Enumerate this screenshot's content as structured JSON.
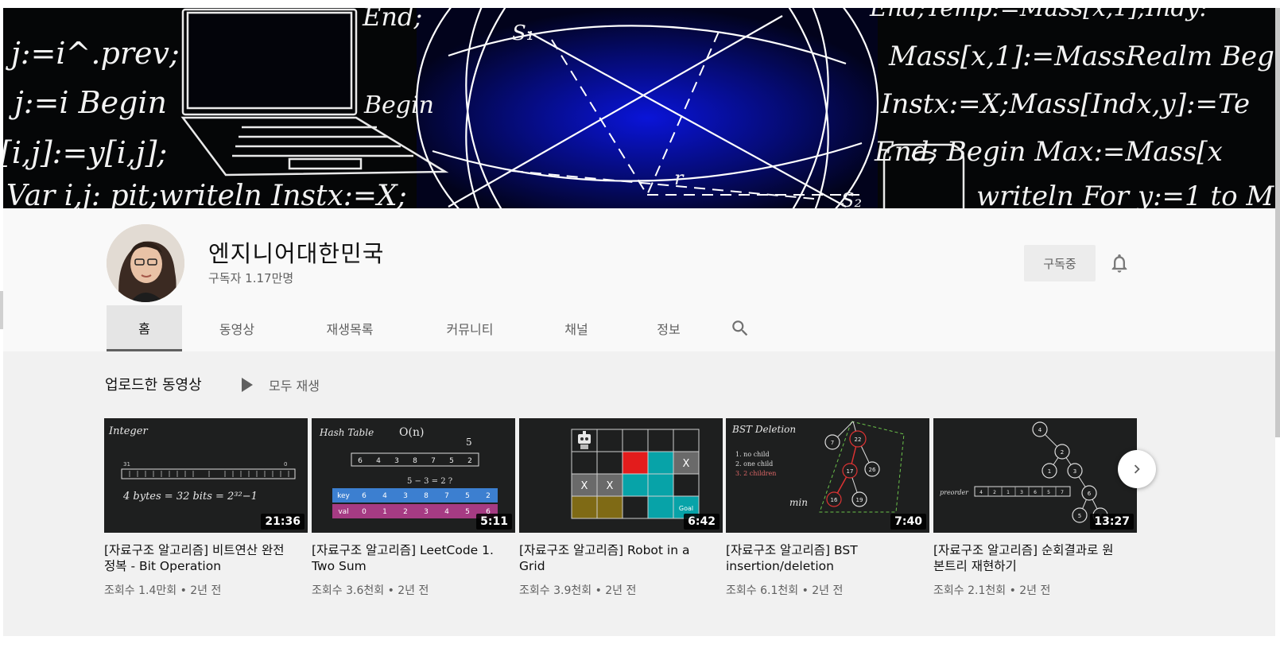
{
  "channel": {
    "name": "엔지니어대한민국",
    "subscribers": "구독자 1.17만명",
    "subscribe_label": "구독중"
  },
  "tabs": [
    {
      "label": "홈",
      "active": true
    },
    {
      "label": "동영상"
    },
    {
      "label": "재생목록"
    },
    {
      "label": "커뮤니티"
    },
    {
      "label": "채널"
    },
    {
      "label": "정보"
    }
  ],
  "shelf": {
    "title": "업로드한 동영상",
    "play_all": "모두 재생"
  },
  "videos": [
    {
      "title": "[자료구조 알고리즘] 비트연산 완전정복 - Bit Operation",
      "duration": "21:36",
      "meta": "조회수 1.4만회 • 2년 전"
    },
    {
      "title": "[자료구조 알고리즘] LeetCode 1. Two Sum",
      "duration": "5:11",
      "meta": "조회수 3.6천회 • 2년 전"
    },
    {
      "title": "[자료구조 알고리즘] Robot in a Grid",
      "duration": "6:42",
      "meta": "조회수 3.9천회 • 2년 전"
    },
    {
      "title": "[자료구조 알고리즘] BST insertion/deletion",
      "duration": "7:40",
      "meta": "조회수 6.1천회 • 2년 전"
    },
    {
      "title": "[자료구조 알고리즘] 순회결과로 원본트리 재현하기",
      "duration": "13:27",
      "meta": "조회수 2.1천회 • 2년 전"
    }
  ],
  "banner_text": {
    "left1": "j:=i^.prev;",
    "left2": "j:=i  Begin",
    "left3": "[i,j]:=y[i,j];",
    "left4": "Var i,j: pit;writeln Instx:=X;",
    "mid_top": "End;",
    "mid_begin": "Begin",
    "s1": "S₁",
    "s2": "S₂",
    "r": "r",
    "right1": "Mass[x,1]:=MassRealm Beg",
    "right2": "Instx:=X;Mass[Indx,y]:=Te",
    "right3": "End;  Begin Max:=Mass[x",
    "right4": "writeln For y:=1 to M",
    "right0": "End;Temp:=Mass[x,1];Indy:"
  },
  "thumb_text": {
    "t1_title": "Integer",
    "t1_formula": "4 bytes = 32 bits = 2³²−1",
    "t1_bit31": "31",
    "t1_bit0": "0",
    "t2_title": "Hash Table",
    "t2_on": "O(n)",
    "t2_target": "5",
    "t2_eq": "5 − 3 = 2 ?",
    "t2_key": "key",
    "t2_val": "val",
    "t2_row": [
      "6",
      "4",
      "3",
      "8",
      "7",
      "5",
      "2"
    ],
    "t2_keys": [
      "6",
      "4",
      "3",
      "8",
      "7",
      "5",
      "2"
    ],
    "t2_idx": [
      "0",
      "1",
      "2",
      "3",
      "4",
      "5",
      "6"
    ],
    "t3_x": "X",
    "t3_goal": "Goal",
    "t4_title": "BST Deletion",
    "t4_l1": "1. no child",
    "t4_l2": "2. one child",
    "t4_l3": "3. 2 children",
    "t4_min": "min",
    "t4_nodes": [
      "7",
      "22",
      "26",
      "17",
      "16",
      "19"
    ],
    "t5_label": "preorder",
    "t5_nodes": [
      "4",
      "2",
      "1",
      "3",
      "6",
      "5",
      "7"
    ],
    "t5_seq": [
      "4",
      "2",
      "1",
      "3",
      "6",
      "5",
      "7"
    ]
  }
}
